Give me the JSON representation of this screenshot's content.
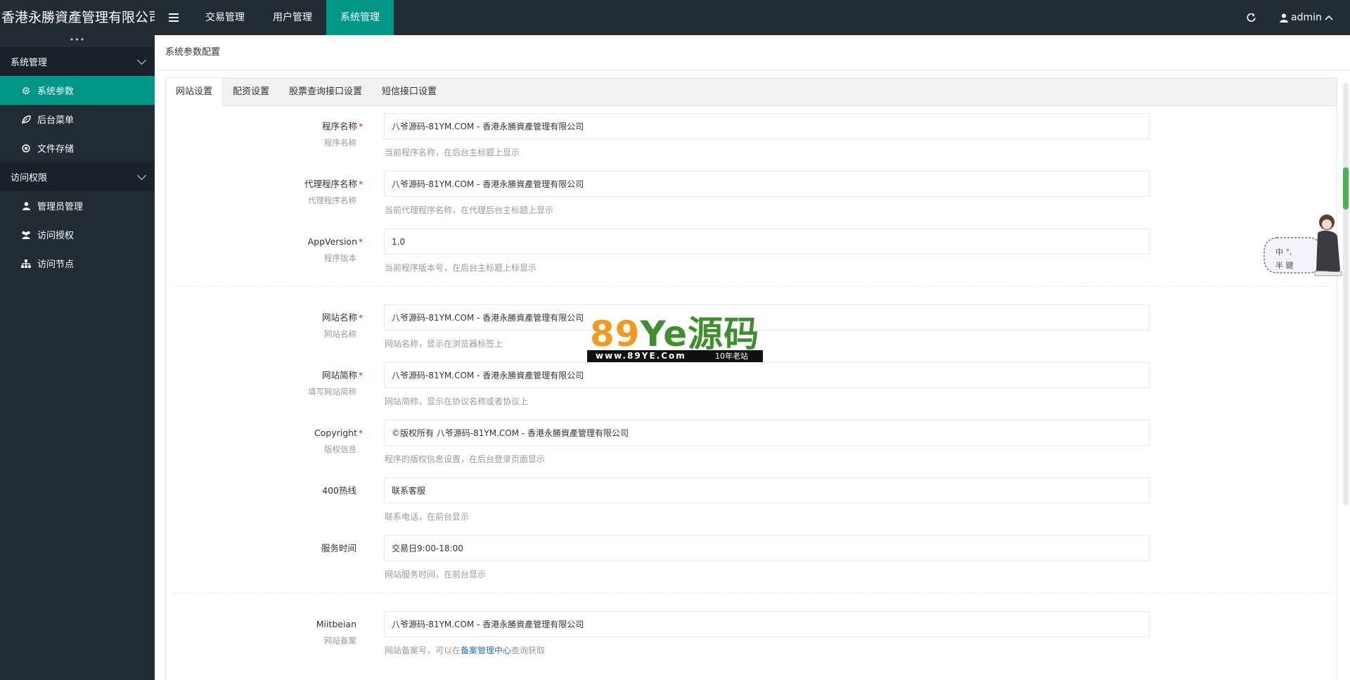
{
  "app": {
    "brand": "香港永勝資產管理有限公司",
    "user": "admin"
  },
  "topnav": [
    {
      "label": "交易管理",
      "active": false
    },
    {
      "label": "用户管理",
      "active": false
    },
    {
      "label": "系统管理",
      "active": true
    }
  ],
  "sidebar": {
    "dots": "•••",
    "groups": [
      {
        "label": "系统管理",
        "items": [
          {
            "label": "系统参数",
            "icon": "gear-icon",
            "active": true
          },
          {
            "label": "后台菜单",
            "icon": "leaf-icon",
            "active": false
          },
          {
            "label": "文件存储",
            "icon": "circle-dot-icon",
            "active": false
          }
        ]
      },
      {
        "label": "访问权限",
        "items": [
          {
            "label": "管理员管理",
            "icon": "user-icon",
            "active": false
          },
          {
            "label": "访问授权",
            "icon": "users-icon",
            "active": false
          },
          {
            "label": "访问节点",
            "icon": "sitemap-icon",
            "active": false
          }
        ]
      }
    ]
  },
  "page": {
    "title": "系统参数配置"
  },
  "tabs": [
    {
      "label": "网站设置",
      "active": true
    },
    {
      "label": "配资设置",
      "active": false
    },
    {
      "label": "股票查询接口设置",
      "active": false
    },
    {
      "label": "短信接口设置",
      "active": false
    }
  ],
  "form": {
    "rows": [
      {
        "label": "程序名称",
        "required": true,
        "sub": "程序名称",
        "value": "八爷源码-81YM.COM - 香港永勝資產管理有限公司",
        "help": "当前程序名称，在后台主标题上显示"
      },
      {
        "label": "代理程序名称",
        "required": true,
        "sub": "代理程序名称",
        "value": "八爷源码-81YM.COM - 香港永勝資產管理有限公司",
        "help": "当前代理程序名称，在代理后台主标题上显示"
      },
      {
        "label": "AppVersion",
        "required": true,
        "sub": "程序版本",
        "value": "1.0",
        "help": "当前程序版本号，在后台主标题上标显示"
      },
      {
        "label": "网站名称",
        "required": true,
        "sub": "网站名称",
        "value": "八爷源码-81YM.COM - 香港永勝資產管理有限公司",
        "help": "网站名称，显示在浏览器标签上"
      },
      {
        "label": "网站简称",
        "required": true,
        "sub": "填写网站简称",
        "value": "八爷源码-81YM.COM - 香港永勝資產管理有限公司",
        "help": "网站简称，显示在协议名称或者协议上"
      },
      {
        "label": "Copyright",
        "required": true,
        "sub": "版权信息",
        "value": "©版权所有 八爷源码-81YM.COM - 香港永勝資產管理有限公司",
        "help": "程序的版权信息设置，在后台登录页面显示"
      },
      {
        "label": "400热线",
        "required": false,
        "sub": "",
        "value": "联系客服",
        "help": "联系电话，在前台显示"
      },
      {
        "label": "服务时间",
        "required": false,
        "sub": "",
        "value": "交易日9:00-18:00",
        "help": "网站服务时间，在前台显示"
      },
      {
        "label": "Miitbeian",
        "required": false,
        "sub": "网站备案",
        "value": "八爷源码-81YM.COM - 香港永勝資產管理有限公司",
        "help_prefix": "网站备案号，可以在",
        "help_link": "备案管理中心",
        "help_suffix": "查询获取"
      }
    ]
  },
  "watermark": {
    "brand": "89Ye源码",
    "site": "www.89YE.Com",
    "tagline": "10年老站"
  },
  "mascot": {
    "text1": "中 °,",
    "text2": "半 鍵"
  },
  "colors": {
    "topbar": "#222c35",
    "accent": "#009688",
    "required": "#e02020"
  }
}
